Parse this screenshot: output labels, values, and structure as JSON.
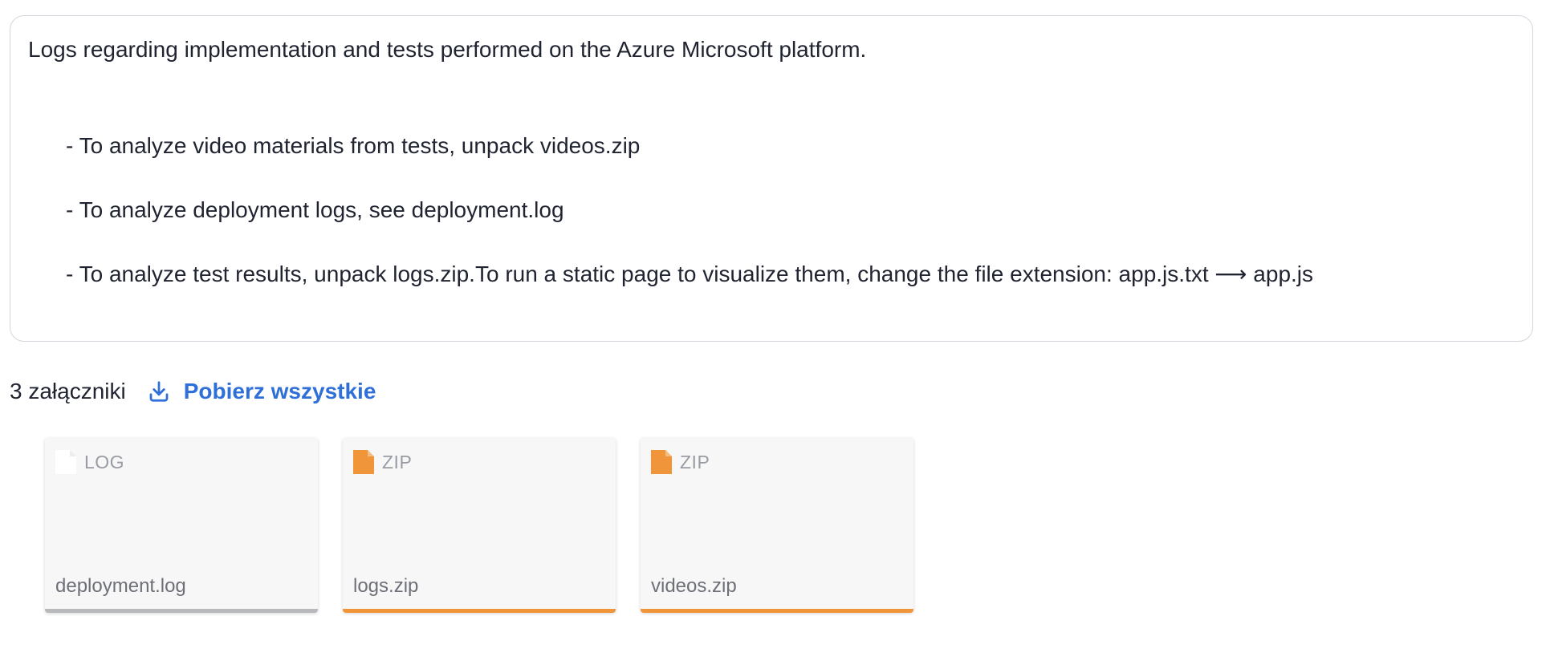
{
  "message": {
    "intro": "Logs regarding implementation and tests performed on the Azure Microsoft platform.",
    "items": [
      "- To analyze video materials from tests, unpack videos.zip",
      "- To analyze deployment logs, see deployment.log",
      "- To analyze test results, unpack logs.zip.To run a static page to visualize them, change the file extension: app.js.txt ⟶ app.js"
    ]
  },
  "attachments": {
    "count_label": "3 załączniki",
    "download_all_label": "Pobierz wszystkie",
    "download_icon": "download-icon",
    "colors": {
      "link": "#2f6fd8",
      "zip_accent": "#f0953a",
      "log_accent": "#b8b9bd"
    },
    "files": [
      {
        "type": "LOG",
        "name": "deployment.log",
        "icon": "file-icon"
      },
      {
        "type": "ZIP",
        "name": "logs.zip",
        "icon": "zip-file-icon"
      },
      {
        "type": "ZIP",
        "name": "videos.zip",
        "icon": "zip-file-icon"
      }
    ]
  }
}
